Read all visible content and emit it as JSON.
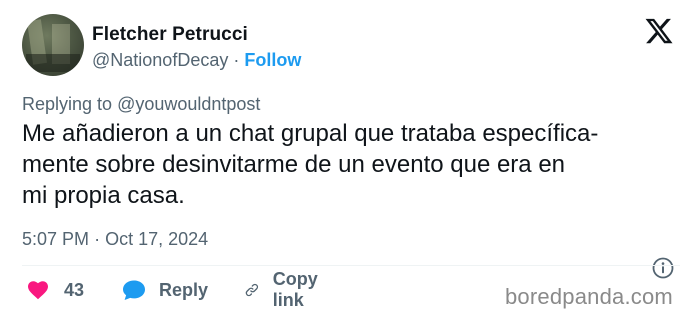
{
  "author": {
    "name": "Fletcher Petrucci",
    "handle": "@NationofDecay",
    "separator": "·",
    "follow_label": "Follow"
  },
  "reply_context": {
    "prefix": "Replying to",
    "mention": "@youwouldntpost"
  },
  "tweet": {
    "lines": [
      "Me añadieron a un chat grupal que trataba específica-",
      "mente sobre desinvitarme de un evento que era en",
      "mi propia casa."
    ]
  },
  "timestamp": {
    "time": "5:07 PM",
    "separator": "·",
    "date": "Oct 17, 2024"
  },
  "actions": {
    "like_count": "43",
    "reply_label": "Reply",
    "copy_link_label": "Copy link"
  },
  "watermark": "boredpanda.com",
  "colors": {
    "accent": "#1d9bf0",
    "like": "#f91880",
    "muted": "#536471",
    "text": "#0f1419"
  },
  "icons": [
    "x-logo-icon",
    "info-icon",
    "heart-icon",
    "reply-bubble-icon",
    "link-icon"
  ]
}
